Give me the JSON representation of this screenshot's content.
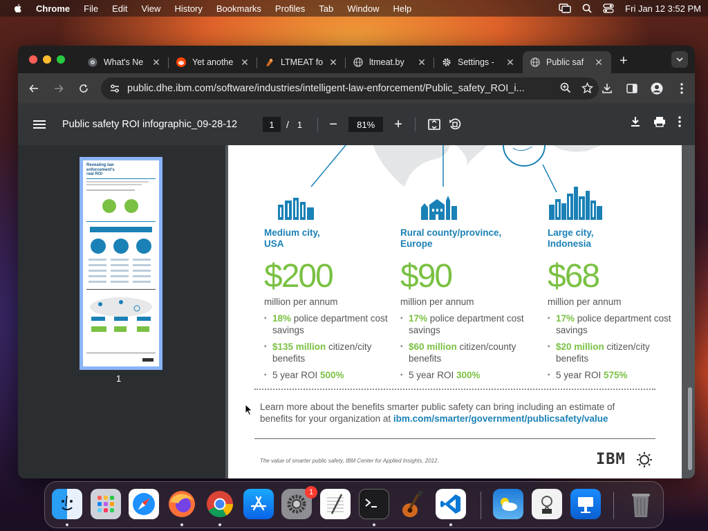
{
  "menubar": {
    "app_name": "Chrome",
    "items": [
      "File",
      "Edit",
      "View",
      "History",
      "Bookmarks",
      "Profiles",
      "Tab",
      "Window",
      "Help"
    ],
    "clock": "Fri Jan 12  3:52 PM"
  },
  "tabs": [
    {
      "title": "What's Ne",
      "icon": "chrome-icon"
    },
    {
      "title": "Yet anothe",
      "icon": "reddit-icon"
    },
    {
      "title": "LTMEAT fo",
      "icon": "ltmeat-icon"
    },
    {
      "title": "ltmeat.by",
      "icon": "globe-icon"
    },
    {
      "title": "Settings -",
      "icon": "gear-icon"
    },
    {
      "title": "Public saf",
      "icon": "globe-icon",
      "active": true
    }
  ],
  "address": {
    "url": "public.dhe.ibm.com/software/industries/intelligent-law-enforcement/Public_safety_ROI_i..."
  },
  "pdf": {
    "title": "Public safety ROI infographic_09-28-12",
    "page_current": "1",
    "page_sep": "/",
    "page_total": "1",
    "zoom": "81%",
    "thumb_page_number": "1",
    "thumb_title": "Revealing law enforcement's real ROI"
  },
  "document": {
    "columns": [
      {
        "city": "Medium city,\nUSA",
        "amount": "$200",
        "unit": "million per annum",
        "b1_value": "18%",
        "b1_text": " police department cost savings",
        "b2_value": "$135 million",
        "b2_text": " citizen/city benefits",
        "b3_text": "5 year ROI ",
        "b3_value": "500%"
      },
      {
        "city": "Rural county/province,\nEurope",
        "amount": "$90",
        "unit": "million per annum",
        "b1_value": "17%",
        "b1_text": " police department cost savings",
        "b2_value": "$60 million",
        "b2_text": " citizen/county benefits",
        "b3_text": "5 year ROI ",
        "b3_value": "300%"
      },
      {
        "city": "Large city,\nIndonesia",
        "amount": "$68",
        "unit": "million per annum",
        "b1_value": "17%",
        "b1_text": " police department cost savings",
        "b2_value": "$20 million",
        "b2_text": " citizen/city benefits",
        "b3_text": "5 year ROI ",
        "b3_value": "575%"
      }
    ],
    "learn_text": "Learn more about the benefits smarter public safety can bring including an estimate of benefits for your organization at ",
    "learn_link": "ibm.com/smarter/government/publicsafety/value",
    "footnote": "The value of smarter public safety, IBM Center for Applied Insights, 2012.",
    "logo": "IBM"
  },
  "dock": {
    "apps": [
      "finder-icon",
      "launchpad-icon",
      "safari-icon",
      "firefox-icon",
      "chrome-icon",
      "app-store-icon",
      "system-settings-icon",
      "textedit-icon",
      "terminal-icon",
      "garageband-icon",
      "vscode-icon",
      "weather-icon",
      "preview-icon",
      "keynote-icon",
      "trash-icon"
    ],
    "settings_badge": "1"
  },
  "colors": {
    "ibm_blue": "#1a81b6",
    "ibm_green": "#7ac143",
    "pdf_toolbar": "#323639"
  }
}
